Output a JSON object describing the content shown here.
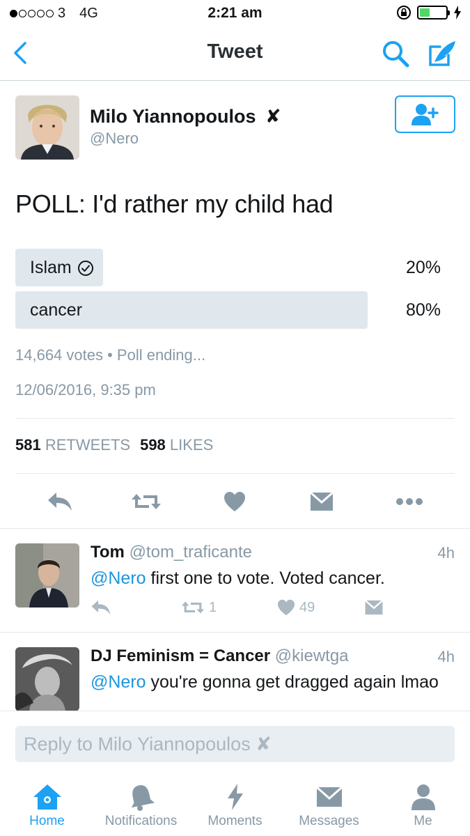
{
  "status_bar": {
    "carrier": "3",
    "network": "4G",
    "time": "2:21 am"
  },
  "nav": {
    "title": "Tweet"
  },
  "tweet": {
    "author_name": "Milo Yiannopoulos",
    "verified_mark": "✘",
    "author_handle": "@Nero",
    "text": "POLL: I'd rather my child had",
    "poll": {
      "options": [
        {
          "label": "Islam",
          "percent_text": "20%",
          "fraction": 0.2,
          "selected": true
        },
        {
          "label": "cancer",
          "percent_text": "80%",
          "fraction": 0.8,
          "selected": false
        }
      ],
      "meta": "14,664 votes • Poll ending..."
    },
    "timestamp": "12/06/2016, 9:35 pm",
    "stats": {
      "retweets_count": "581",
      "retweets_label": "RETWEETS",
      "likes_count": "598",
      "likes_label": "LIKES"
    }
  },
  "replies": [
    {
      "name": "Tom",
      "handle": "@tom_traficante",
      "time": "4h",
      "mention": "@Nero",
      "text": " first one to vote. Voted cancer.",
      "retweets": "1",
      "likes": "49"
    },
    {
      "name": "DJ Feminism = Cancer",
      "handle": "@kiewtga",
      "time": "4h",
      "mention": "@Nero",
      "text": " you're gonna get dragged again lmao"
    }
  ],
  "reply_bar": {
    "placeholder": "Reply to Milo Yiannopoulos ✘"
  },
  "tabbar": {
    "items": [
      {
        "label": "Home",
        "icon": "home-icon",
        "active": true
      },
      {
        "label": "Notifications",
        "icon": "bell-icon",
        "active": false
      },
      {
        "label": "Moments",
        "icon": "lightning-icon",
        "active": false
      },
      {
        "label": "Messages",
        "icon": "envelope-icon",
        "active": false
      },
      {
        "label": "Me",
        "icon": "person-icon",
        "active": false
      }
    ]
  },
  "colors": {
    "accent": "#1da1f2",
    "muted": "#8899a6",
    "poll_bar": "#e1e8ed"
  }
}
